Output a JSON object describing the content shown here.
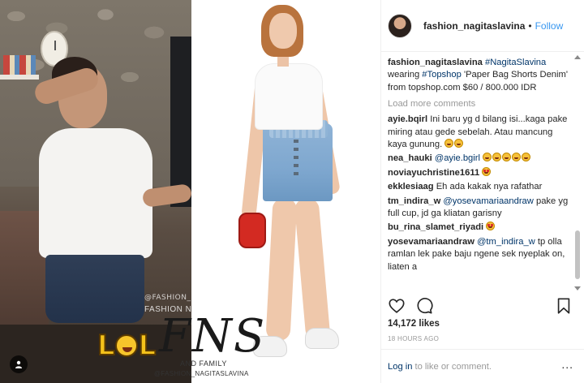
{
  "post": {
    "username": "fashion_nagitaslavina",
    "follow_label": "Follow",
    "header_separator": "•"
  },
  "media": {
    "watermark_handle_top": "@FASHION_NAGITASLAVINA",
    "watermark_name": "FASHION NAGITA SLAVINA",
    "watermark_logo": "FNS",
    "watermark_family": "AND FAMILY",
    "watermark_handle_bottom": "@FASHION_NAGITASLAVINA",
    "sticker_text_start": "L",
    "sticker_text_end": "L",
    "sticker_icon": "laughing-face-emoji",
    "tag_icon": "user-tag-icon"
  },
  "caption": {
    "username": "fashion_nagitaslavina",
    "hashtag_name": "#NagitaSlavina",
    "text_1": "wearing",
    "hashtag_brand": "#Topshop",
    "text_2": "'Paper Bag Shorts Denim' from topshop.com $60 / 800.000 IDR"
  },
  "load_more": "Load more comments",
  "comments": [
    {
      "user": "ayie.bqirl",
      "text": "Ini baru yg d bilang isi...kaga pake miring atau gede sebelah. Atau mancung kaya gunung.",
      "emoji": [
        "grin-sweat",
        "grin-sweat"
      ]
    },
    {
      "user": "nea_hauki",
      "mention": "@ayie.bgirl",
      "text": "",
      "emoji": [
        "grin-sweat",
        "grin-sweat",
        "grin-sweat",
        "grin-sweat",
        "grin-sweat"
      ]
    },
    {
      "user": "noviayuchristine1611",
      "text": "",
      "emoji": [
        "heart-eyes"
      ]
    },
    {
      "user": "ekklesiaag",
      "text": "Eh ada kakak nya rafathar",
      "emoji": []
    },
    {
      "user": "tm_indira_w",
      "mention": "@yosevamariaandraw",
      "text": "pake yg full cup, jd ga kliatan garisny",
      "emoji": []
    },
    {
      "user": "bu_rina_slamet_riyadi",
      "text": "",
      "emoji": [
        "heart-eyes"
      ]
    },
    {
      "user": "yosevamariaandraw",
      "mention": "@tm_indira_w",
      "text": "tp olla ramlan lek pake baju ngene sek nyeplak on, liaten a",
      "emoji": []
    }
  ],
  "actions": {
    "like_icon": "heart-icon",
    "comment_icon": "comment-icon",
    "save_icon": "bookmark-icon"
  },
  "likes": "14,172 likes",
  "timestamp": "18 HOURS AGO",
  "footer": {
    "login_label": "Log in",
    "suffix": "to like or comment.",
    "more_label": "..."
  },
  "colors": {
    "link_blue": "#3897f0",
    "tag_navy": "#003569",
    "muted": "#999999",
    "text": "#262626"
  }
}
